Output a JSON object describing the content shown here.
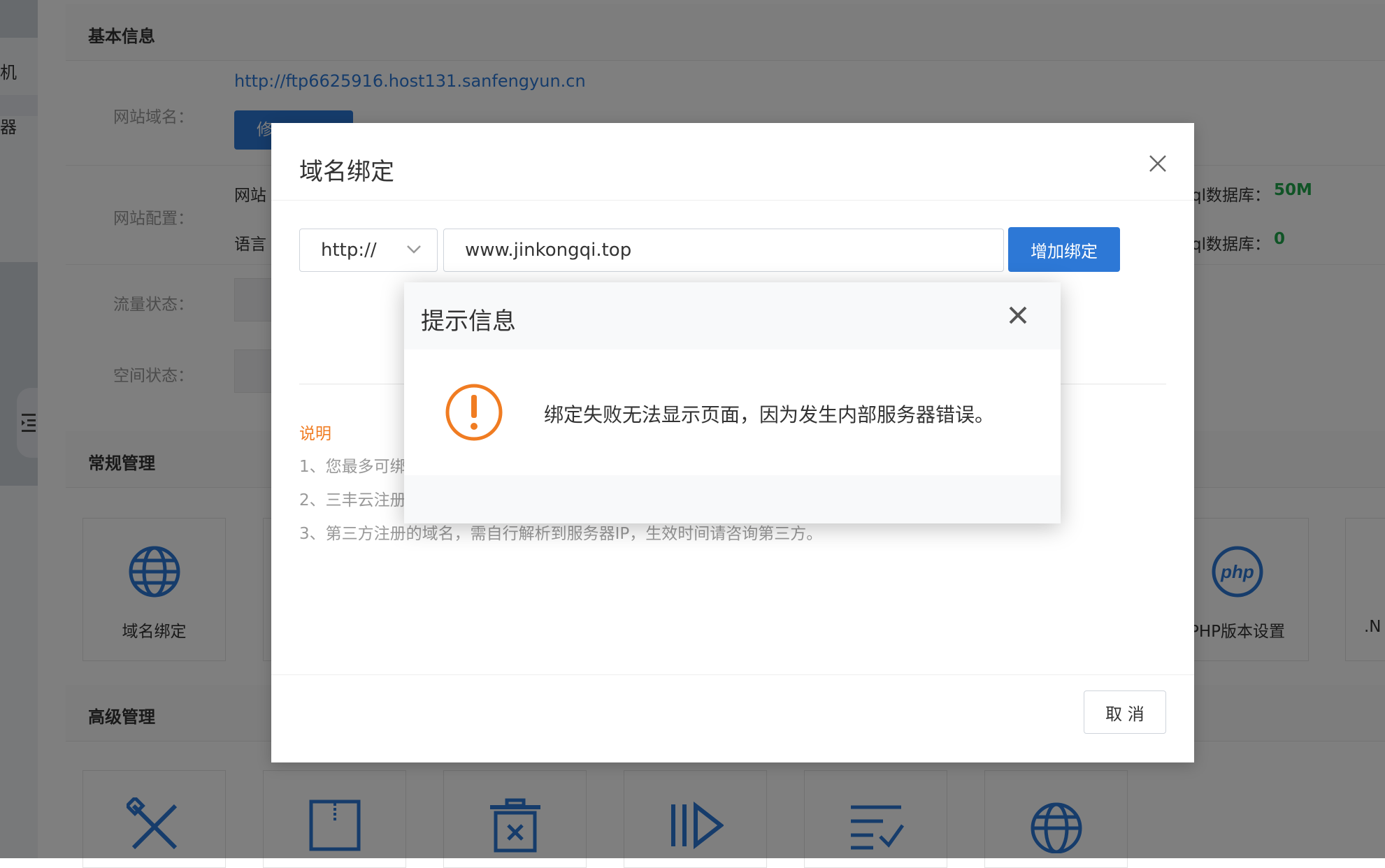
{
  "sidebar": {
    "items": [
      {
        "label": "机"
      },
      {
        "label": "器"
      }
    ]
  },
  "basic_info": {
    "heading": "基本信息",
    "domain_label": "网站域名：",
    "domain_link": "http://ftp6625916.host131.sanfengyun.cn",
    "modify_button": "修",
    "config_label": "网站配置：",
    "config_line1": "网站",
    "config_line2": "语言",
    "mysql1_label": "ql数据库：",
    "mysql1_value": "50M",
    "mysql2_label": "ql数据库：",
    "mysql2_value": "0",
    "traffic_label": "流量状态：",
    "space_label": "空间状态："
  },
  "regular": {
    "heading": "常规管理",
    "cards": [
      {
        "label": "域名绑定",
        "icon": "globe-icon"
      },
      {
        "label": "PHP版本设置",
        "icon": "php-icon"
      },
      {
        "label": ".N",
        "icon": ""
      }
    ]
  },
  "advanced": {
    "heading": "高级管理",
    "cards": [
      {
        "icon": "tools-icon"
      },
      {
        "icon": "zip-file-icon"
      },
      {
        "icon": "trash-icon"
      },
      {
        "icon": "play-icon"
      },
      {
        "icon": "checklist-icon"
      },
      {
        "icon": "globe-icon"
      }
    ]
  },
  "bind_dialog": {
    "title": "域名绑定",
    "protocol": "http://",
    "domain_value": "www.jinkongqi.top",
    "add_button": "增加绑定",
    "note_title": "说明",
    "notes": [
      "1、您最多可绑",
      "2、三丰云注册",
      "3、第三方注册的域名，需自行解析到服务器IP，生效时间请咨询第三方。"
    ],
    "cancel_button": "取 消"
  },
  "alert_dialog": {
    "title": "提示信息",
    "message": "绑定失败无法显示页面，因为发生内部服务器错误。"
  },
  "colors": {
    "primary": "#2d78d6",
    "warning": "#f07c22",
    "success": "#21a94d"
  }
}
